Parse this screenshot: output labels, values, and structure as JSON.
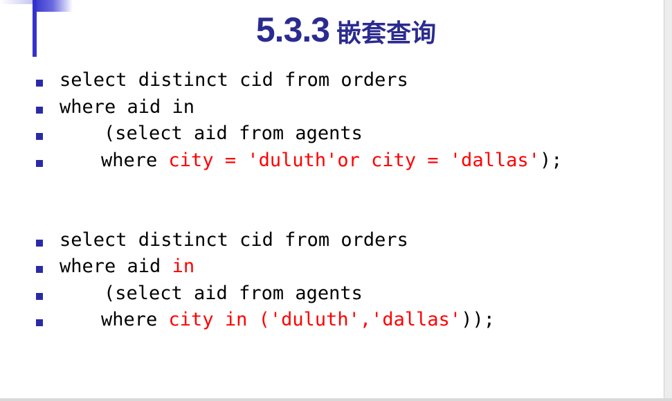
{
  "title": {
    "number": "5.3.3",
    "chinese": "嵌套查询"
  },
  "block1": {
    "l1": "select distinct cid from orders",
    "l2": "where aid in",
    "l3": "(select aid from agents",
    "l4_a": "where ",
    "l4_b": "city = 'duluth'or city = 'dallas'",
    "l4_c": ");"
  },
  "block2": {
    "l1": "select distinct cid from orders",
    "l2_a": "where aid ",
    "l2_b": "in",
    "l3": "(select aid from agents",
    "l4_a": "where ",
    "l4_b": "city in ('duluth','dallas'",
    "l4_c": "));"
  },
  "colors": {
    "title": "#2b2b8f",
    "bullet": "#2a2aa8",
    "highlight": "#ff0000"
  }
}
